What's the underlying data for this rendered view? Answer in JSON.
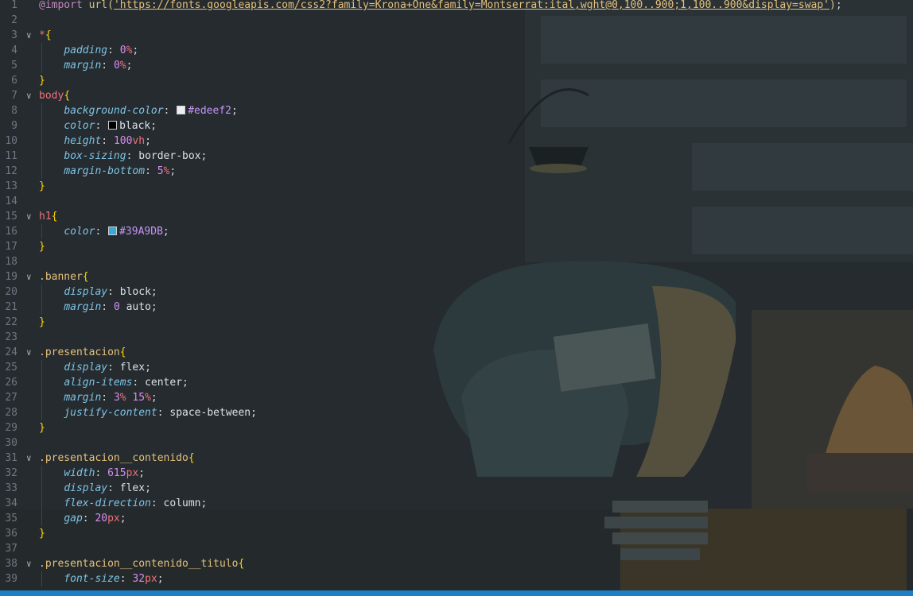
{
  "editor": {
    "language": "css",
    "lines": [
      {
        "n": "1",
        "fold": "",
        "indent": 0,
        "tokens": [
          [
            "at",
            "@import"
          ],
          [
            "punc",
            " "
          ],
          [
            "fn",
            "url("
          ],
          [
            "str",
            "'https://fonts.googleapis.com/css2?family=Krona+One&family=Montserrat:ital,wght@0,100..900;1,100..900&display=swap'"
          ],
          [
            "fn",
            ")"
          ],
          [
            "punc",
            ";"
          ]
        ]
      },
      {
        "n": "2",
        "fold": "",
        "indent": 0,
        "tokens": []
      },
      {
        "n": "3",
        "fold": "v",
        "indent": 0,
        "tokens": [
          [
            "sel",
            "*"
          ],
          [
            "br",
            "{"
          ]
        ]
      },
      {
        "n": "4",
        "fold": "",
        "indent": 1,
        "tokens": [
          [
            "prop",
            "padding"
          ],
          [
            "punc",
            ": "
          ],
          [
            "num",
            "0"
          ],
          [
            "unit",
            "%"
          ],
          [
            "punc",
            ";"
          ]
        ]
      },
      {
        "n": "5",
        "fold": "",
        "indent": 1,
        "tokens": [
          [
            "prop",
            "margin"
          ],
          [
            "punc",
            ": "
          ],
          [
            "num",
            "0"
          ],
          [
            "unit",
            "%"
          ],
          [
            "punc",
            ";"
          ]
        ]
      },
      {
        "n": "6",
        "fold": "",
        "indent": 0,
        "tokens": [
          [
            "br",
            "}"
          ]
        ]
      },
      {
        "n": "7",
        "fold": "v",
        "indent": 0,
        "tokens": [
          [
            "sel",
            "body"
          ],
          [
            "br",
            "{"
          ]
        ]
      },
      {
        "n": "8",
        "fold": "",
        "indent": 1,
        "tokens": [
          [
            "prop",
            "background-color"
          ],
          [
            "punc",
            ": "
          ],
          [
            "swatch",
            "#edeef2"
          ],
          [
            "hex",
            "#edeef2"
          ],
          [
            "punc",
            ";"
          ]
        ]
      },
      {
        "n": "9",
        "fold": "",
        "indent": 1,
        "tokens": [
          [
            "prop",
            "color"
          ],
          [
            "punc",
            ": "
          ],
          [
            "swatch",
            "#000000"
          ],
          [
            "val",
            "black"
          ],
          [
            "punc",
            ";"
          ]
        ]
      },
      {
        "n": "10",
        "fold": "",
        "indent": 1,
        "tokens": [
          [
            "prop",
            "height"
          ],
          [
            "punc",
            ": "
          ],
          [
            "num",
            "100"
          ],
          [
            "unit",
            "vh"
          ],
          [
            "punc",
            ";"
          ]
        ]
      },
      {
        "n": "11",
        "fold": "",
        "indent": 1,
        "tokens": [
          [
            "prop",
            "box-sizing"
          ],
          [
            "punc",
            ": "
          ],
          [
            "val",
            "border-box"
          ],
          [
            "punc",
            ";"
          ]
        ]
      },
      {
        "n": "12",
        "fold": "",
        "indent": 1,
        "tokens": [
          [
            "prop",
            "margin-bottom"
          ],
          [
            "punc",
            ": "
          ],
          [
            "num",
            "5"
          ],
          [
            "unit",
            "%"
          ],
          [
            "punc",
            ";"
          ]
        ]
      },
      {
        "n": "13",
        "fold": "",
        "indent": 0,
        "tokens": [
          [
            "br",
            "}"
          ]
        ]
      },
      {
        "n": "14",
        "fold": "",
        "indent": 0,
        "tokens": []
      },
      {
        "n": "15",
        "fold": "v",
        "indent": 0,
        "tokens": [
          [
            "sel",
            "h1"
          ],
          [
            "br",
            "{"
          ]
        ]
      },
      {
        "n": "16",
        "fold": "",
        "indent": 1,
        "tokens": [
          [
            "prop",
            "color"
          ],
          [
            "punc",
            ": "
          ],
          [
            "swatch",
            "#39A9DB"
          ],
          [
            "hex",
            "#39A9DB"
          ],
          [
            "punc",
            ";"
          ]
        ]
      },
      {
        "n": "17",
        "fold": "",
        "indent": 0,
        "tokens": [
          [
            "br",
            "}"
          ]
        ]
      },
      {
        "n": "18",
        "fold": "",
        "indent": 0,
        "tokens": []
      },
      {
        "n": "19",
        "fold": "v",
        "indent": 0,
        "tokens": [
          [
            "cls",
            ".banner"
          ],
          [
            "br",
            "{"
          ]
        ]
      },
      {
        "n": "20",
        "fold": "",
        "indent": 1,
        "tokens": [
          [
            "prop",
            "display"
          ],
          [
            "punc",
            ": "
          ],
          [
            "val",
            "block"
          ],
          [
            "punc",
            ";"
          ]
        ]
      },
      {
        "n": "21",
        "fold": "",
        "indent": 1,
        "tokens": [
          [
            "prop",
            "margin"
          ],
          [
            "punc",
            ": "
          ],
          [
            "num",
            "0"
          ],
          [
            "val",
            " auto"
          ],
          [
            "punc",
            ";"
          ]
        ]
      },
      {
        "n": "22",
        "fold": "",
        "indent": 0,
        "tokens": [
          [
            "br",
            "}"
          ]
        ]
      },
      {
        "n": "23",
        "fold": "",
        "indent": 0,
        "tokens": []
      },
      {
        "n": "24",
        "fold": "v",
        "indent": 0,
        "tokens": [
          [
            "cls",
            ".presentacion"
          ],
          [
            "br",
            "{"
          ]
        ]
      },
      {
        "n": "25",
        "fold": "",
        "indent": 1,
        "tokens": [
          [
            "prop",
            "display"
          ],
          [
            "punc",
            ": "
          ],
          [
            "val",
            "flex"
          ],
          [
            "punc",
            ";"
          ]
        ]
      },
      {
        "n": "26",
        "fold": "",
        "indent": 1,
        "tokens": [
          [
            "prop",
            "align-items"
          ],
          [
            "punc",
            ": "
          ],
          [
            "val",
            "center"
          ],
          [
            "punc",
            ";"
          ]
        ]
      },
      {
        "n": "27",
        "fold": "",
        "indent": 1,
        "tokens": [
          [
            "prop",
            "margin"
          ],
          [
            "punc",
            ": "
          ],
          [
            "num",
            "3"
          ],
          [
            "unit",
            "%"
          ],
          [
            "punc",
            " "
          ],
          [
            "num",
            "15"
          ],
          [
            "unit",
            "%"
          ],
          [
            "punc",
            ";"
          ]
        ]
      },
      {
        "n": "28",
        "fold": "",
        "indent": 1,
        "tokens": [
          [
            "prop",
            "justify-content"
          ],
          [
            "punc",
            ": "
          ],
          [
            "val",
            "space-between"
          ],
          [
            "punc",
            ";"
          ]
        ]
      },
      {
        "n": "29",
        "fold": "",
        "indent": 0,
        "tokens": [
          [
            "br",
            "}"
          ]
        ]
      },
      {
        "n": "30",
        "fold": "",
        "indent": 0,
        "tokens": []
      },
      {
        "n": "31",
        "fold": "v",
        "indent": 0,
        "tokens": [
          [
            "cls",
            ".presentacion__contenido"
          ],
          [
            "br",
            "{"
          ]
        ]
      },
      {
        "n": "32",
        "fold": "",
        "indent": 1,
        "tokens": [
          [
            "prop",
            "width"
          ],
          [
            "punc",
            ": "
          ],
          [
            "num",
            "615"
          ],
          [
            "unit",
            "px"
          ],
          [
            "punc",
            ";"
          ]
        ]
      },
      {
        "n": "33",
        "fold": "",
        "indent": 1,
        "tokens": [
          [
            "prop",
            "display"
          ],
          [
            "punc",
            ": "
          ],
          [
            "val",
            "flex"
          ],
          [
            "punc",
            ";"
          ]
        ]
      },
      {
        "n": "34",
        "fold": "",
        "indent": 1,
        "tokens": [
          [
            "prop",
            "flex-direction"
          ],
          [
            "punc",
            ": "
          ],
          [
            "val",
            "column"
          ],
          [
            "punc",
            ";"
          ]
        ]
      },
      {
        "n": "35",
        "fold": "",
        "indent": 1,
        "tokens": [
          [
            "prop",
            "gap"
          ],
          [
            "punc",
            ": "
          ],
          [
            "num",
            "20"
          ],
          [
            "unit",
            "px"
          ],
          [
            "punc",
            ";"
          ]
        ]
      },
      {
        "n": "36",
        "fold": "",
        "indent": 0,
        "tokens": [
          [
            "br",
            "}"
          ]
        ]
      },
      {
        "n": "37",
        "fold": "",
        "indent": 0,
        "tokens": []
      },
      {
        "n": "38",
        "fold": "v",
        "indent": 0,
        "tokens": [
          [
            "cls",
            ".presentacion__contenido__titulo"
          ],
          [
            "br",
            "{"
          ]
        ]
      },
      {
        "n": "39",
        "fold": "",
        "indent": 1,
        "tokens": [
          [
            "prop",
            "font-size"
          ],
          [
            "punc",
            ": "
          ],
          [
            "num",
            "32"
          ],
          [
            "unit",
            "px"
          ],
          [
            "punc",
            ";"
          ]
        ]
      }
    ]
  },
  "colors": {
    "status_bar": "#1f7fc4",
    "editor_background": "#242a2e"
  },
  "icons": {
    "fold_marker": "chevron-down-icon"
  }
}
